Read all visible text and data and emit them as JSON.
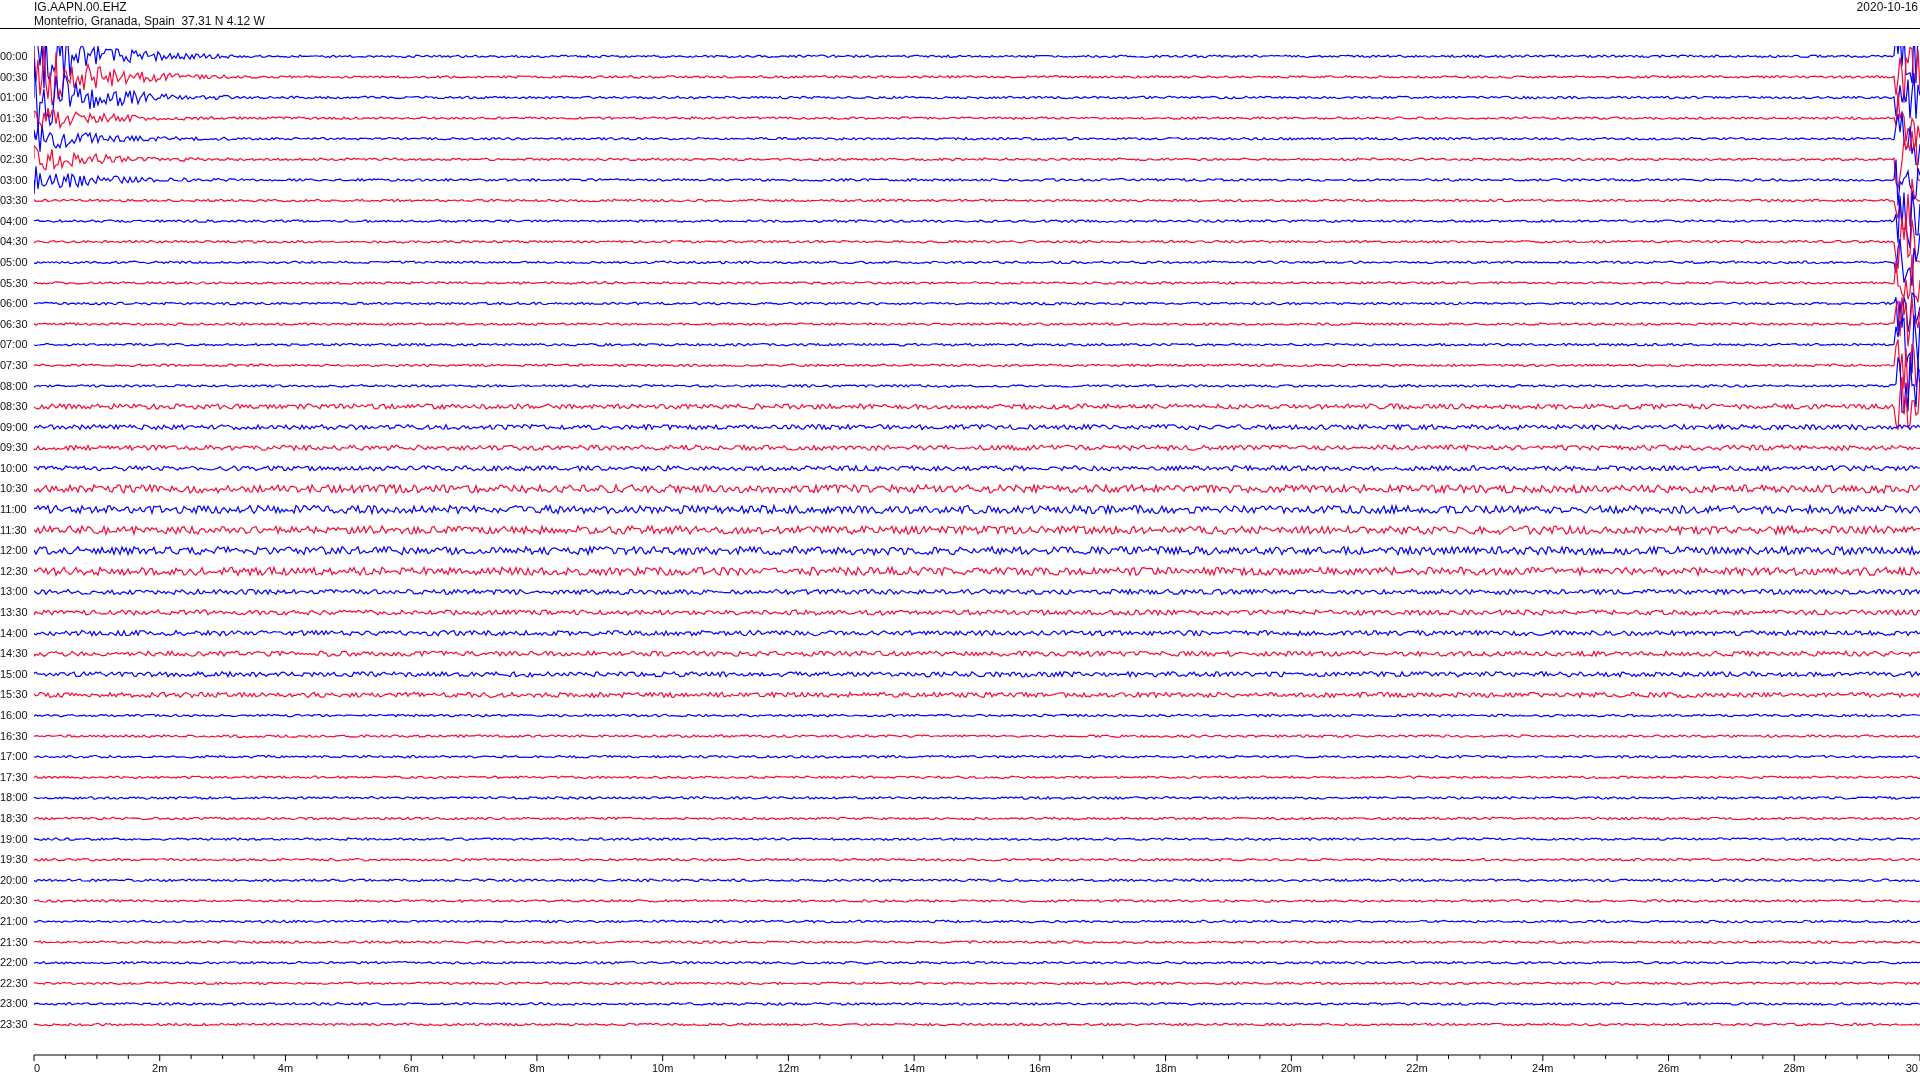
{
  "header": {
    "station": "IG.AAPN.00.EHZ",
    "location": "Montefrio, Granada, Spain  37.31 N 4.12 W",
    "date": "2020-10-16"
  },
  "rows": [
    {
      "label": "00:00",
      "color": "#0000ff"
    },
    {
      "label": "00:30",
      "color": "#f50a35"
    },
    {
      "label": "01:00",
      "color": "#0000ff"
    },
    {
      "label": "01:30",
      "color": "#f50a35"
    },
    {
      "label": "02:00",
      "color": "#0000ff"
    },
    {
      "label": "02:30",
      "color": "#f50a35"
    },
    {
      "label": "03:00",
      "color": "#0000ff"
    },
    {
      "label": "03:30",
      "color": "#f50a35"
    },
    {
      "label": "04:00",
      "color": "#0000ff"
    },
    {
      "label": "04:30",
      "color": "#f50a35"
    },
    {
      "label": "05:00",
      "color": "#0000ff"
    },
    {
      "label": "05:30",
      "color": "#f50a35"
    },
    {
      "label": "06:00",
      "color": "#0000ff"
    },
    {
      "label": "06:30",
      "color": "#f50a35"
    },
    {
      "label": "07:00",
      "color": "#0000ff"
    },
    {
      "label": "07:30",
      "color": "#f50a35"
    },
    {
      "label": "08:00",
      "color": "#0000ff"
    },
    {
      "label": "08:30",
      "color": "#f50a35"
    },
    {
      "label": "09:00",
      "color": "#0000ff"
    },
    {
      "label": "09:30",
      "color": "#f50a35"
    },
    {
      "label": "10:00",
      "color": "#0000ff"
    },
    {
      "label": "10:30",
      "color": "#f50a35"
    },
    {
      "label": "11:00",
      "color": "#0000ff"
    },
    {
      "label": "11:30",
      "color": "#f50a35"
    },
    {
      "label": "12:00",
      "color": "#0000ff"
    },
    {
      "label": "12:30",
      "color": "#f50a35"
    },
    {
      "label": "13:00",
      "color": "#0000ff"
    },
    {
      "label": "13:30",
      "color": "#f50a35"
    },
    {
      "label": "14:00",
      "color": "#0000ff"
    },
    {
      "label": "14:30",
      "color": "#f50a35"
    },
    {
      "label": "15:00",
      "color": "#0000ff"
    },
    {
      "label": "15:30",
      "color": "#f50a35"
    },
    {
      "label": "16:00",
      "color": "#0000ff"
    },
    {
      "label": "16:30",
      "color": "#f50a35"
    },
    {
      "label": "17:00",
      "color": "#0000ff"
    },
    {
      "label": "17:30",
      "color": "#f50a35"
    },
    {
      "label": "18:00",
      "color": "#0000ff"
    },
    {
      "label": "18:30",
      "color": "#f50a35"
    },
    {
      "label": "19:00",
      "color": "#0000ff"
    },
    {
      "label": "19:30",
      "color": "#f50a35"
    },
    {
      "label": "20:00",
      "color": "#0000ff"
    },
    {
      "label": "20:30",
      "color": "#f50a35"
    },
    {
      "label": "21:00",
      "color": "#0000ff"
    },
    {
      "label": "21:30",
      "color": "#f50a35"
    },
    {
      "label": "22:00",
      "color": "#0000ff"
    },
    {
      "label": "22:30",
      "color": "#f50a35"
    },
    {
      "label": "23:00",
      "color": "#0000ff"
    },
    {
      "label": "23:30",
      "color": "#f50a35"
    }
  ],
  "x_ticks": [
    "0",
    "2m",
    "4m",
    "6m",
    "8m",
    "10m",
    "12m",
    "14m",
    "16m",
    "18m",
    "20m",
    "22m",
    "24m",
    "26m",
    "28m",
    "30"
  ]
}
